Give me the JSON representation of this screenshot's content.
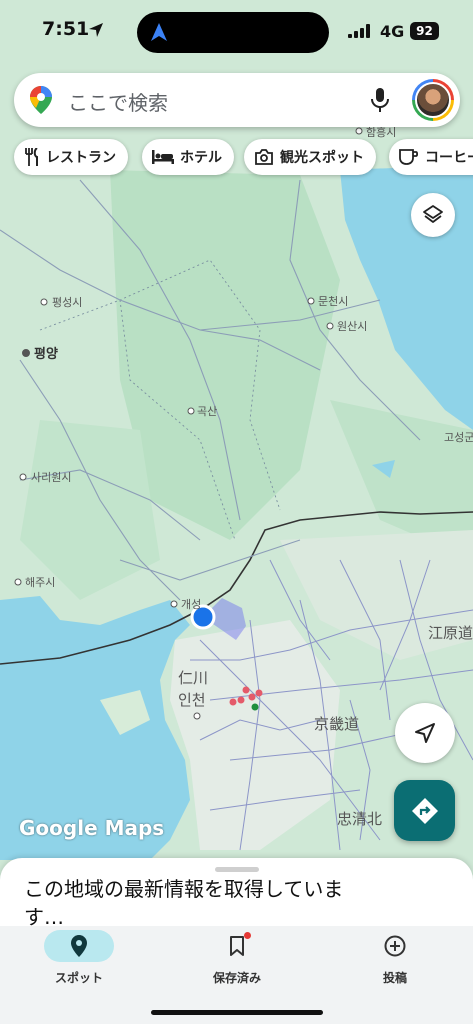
{
  "status_bar": {
    "time": "7:51",
    "network": "4G",
    "battery": "92"
  },
  "search": {
    "placeholder": "ここで検索"
  },
  "chips": [
    {
      "label": "レストラン",
      "icon": "fork-knife-icon"
    },
    {
      "label": "ホテル",
      "icon": "bed-icon"
    },
    {
      "label": "観光スポット",
      "icon": "camera-icon"
    },
    {
      "label": "コーヒー",
      "icon": "coffee-icon"
    }
  ],
  "map": {
    "labels": {
      "hamhung": "함흥시",
      "pyongseong": "평성시",
      "pyongyang": "평양",
      "munchon": "문천시",
      "wonsan": "원산시",
      "goksan": "곡산",
      "goseong": "고성군",
      "sariwon": "사리원시",
      "haeju": "해주시",
      "kaesong": "개성",
      "incheon_jp": "仁川",
      "incheon": "인천",
      "gangwon": "江原道",
      "gyeonggi": "京畿道",
      "chungbuk": "忠清北"
    },
    "attribution": "Google Maps"
  },
  "sheet": {
    "text": "この地域の最新情報を取得しています…"
  },
  "nav": [
    {
      "label": "スポット",
      "icon": "pin-icon",
      "active": true
    },
    {
      "label": "保存済み",
      "icon": "bookmark-icon",
      "active": false
    },
    {
      "label": "投稿",
      "icon": "plus-circle-icon",
      "active": false
    }
  ],
  "colors": {
    "water": "#8fd3e8",
    "land": "#cfe8d6",
    "forest": "#b9e0c4",
    "directions": "#0b6e73",
    "active_tab": "#b9e8ef",
    "location": "#1a73e8"
  }
}
